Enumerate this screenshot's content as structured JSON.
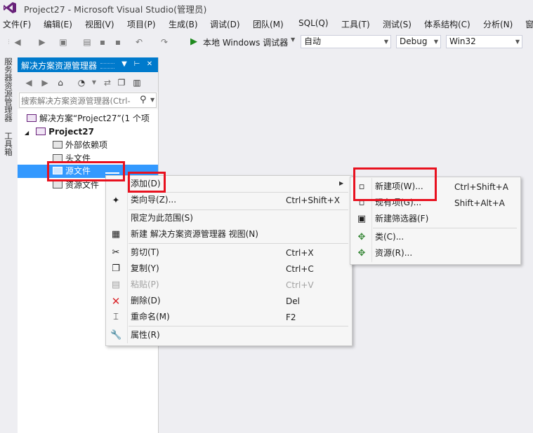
{
  "window": {
    "title": "Project27 - Microsoft Visual Studio(管理员)"
  },
  "menubar": [
    "文件(F)",
    "编辑(E)",
    "视图(V)",
    "项目(P)",
    "生成(B)",
    "调试(D)",
    "团队(M)",
    "SQL(Q)",
    "工具(T)",
    "测试(S)",
    "体系结构(C)",
    "分析(N)",
    "窗"
  ],
  "toolbar": {
    "run_label": "本地 Windows 调试器",
    "config_combo": "自动",
    "build_combo": "Debug",
    "platform_combo": "Win32"
  },
  "side_tabs": {
    "server": "服务器资源管理器",
    "toolbox": "工具箱"
  },
  "solution_explorer": {
    "title": "解决方案资源管理器",
    "search_placeholder": "搜索解决方案资源管理器(Ctrl-",
    "tree": {
      "solution": "解决方案“Project27”(1 个项",
      "project": "Project27",
      "items": [
        "外部依赖项",
        "头文件",
        "源文件",
        "资源文件"
      ]
    }
  },
  "context_menu": {
    "add": "添加(D)",
    "class_wizard": "类向导(Z)...",
    "class_wizard_shortcut": "Ctrl+Shift+X",
    "scope": "限定为此范围(S)",
    "new_view": "新建 解决方案资源管理器 视图(N)",
    "cut": "剪切(T)",
    "cut_shortcut": "Ctrl+X",
    "copy": "复制(Y)",
    "copy_shortcut": "Ctrl+C",
    "paste": "粘贴(P)",
    "paste_shortcut": "Ctrl+V",
    "delete": "删除(D)",
    "delete_shortcut": "Del",
    "rename": "重命名(M)",
    "rename_shortcut": "F2",
    "properties": "属性(R)"
  },
  "submenu": {
    "new_item": "新建项(W)...",
    "new_item_shortcut": "Ctrl+Shift+A",
    "existing_item": "现有项(G)...",
    "existing_item_shortcut": "Shift+Alt+A",
    "new_filter": "新建筛选器(F)",
    "class": "类(C)...",
    "resource": "资源(R)..."
  },
  "colors": {
    "accent": "#007acc",
    "highlight": "#e8111f",
    "selection": "#3399ff"
  }
}
